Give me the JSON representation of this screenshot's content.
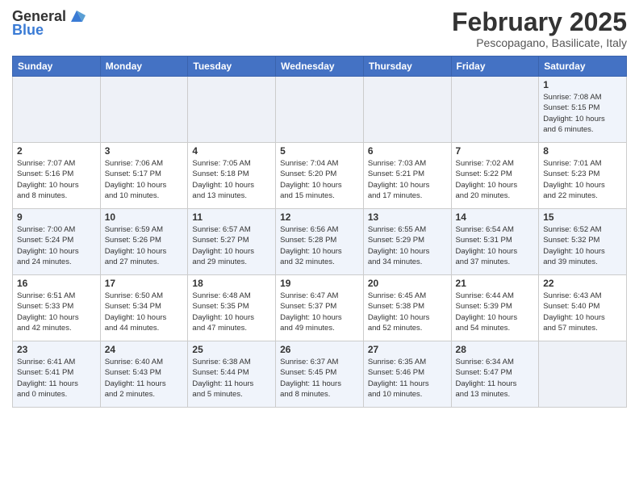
{
  "header": {
    "logo_general": "General",
    "logo_blue": "Blue",
    "month_title": "February 2025",
    "subtitle": "Pescopagano, Basilicate, Italy"
  },
  "weekdays": [
    "Sunday",
    "Monday",
    "Tuesday",
    "Wednesday",
    "Thursday",
    "Friday",
    "Saturday"
  ],
  "weeks": [
    [
      {
        "day": "",
        "info": ""
      },
      {
        "day": "",
        "info": ""
      },
      {
        "day": "",
        "info": ""
      },
      {
        "day": "",
        "info": ""
      },
      {
        "day": "",
        "info": ""
      },
      {
        "day": "",
        "info": ""
      },
      {
        "day": "1",
        "info": "Sunrise: 7:08 AM\nSunset: 5:15 PM\nDaylight: 10 hours\nand 6 minutes."
      }
    ],
    [
      {
        "day": "2",
        "info": "Sunrise: 7:07 AM\nSunset: 5:16 PM\nDaylight: 10 hours\nand 8 minutes."
      },
      {
        "day": "3",
        "info": "Sunrise: 7:06 AM\nSunset: 5:17 PM\nDaylight: 10 hours\nand 10 minutes."
      },
      {
        "day": "4",
        "info": "Sunrise: 7:05 AM\nSunset: 5:18 PM\nDaylight: 10 hours\nand 13 minutes."
      },
      {
        "day": "5",
        "info": "Sunrise: 7:04 AM\nSunset: 5:20 PM\nDaylight: 10 hours\nand 15 minutes."
      },
      {
        "day": "6",
        "info": "Sunrise: 7:03 AM\nSunset: 5:21 PM\nDaylight: 10 hours\nand 17 minutes."
      },
      {
        "day": "7",
        "info": "Sunrise: 7:02 AM\nSunset: 5:22 PM\nDaylight: 10 hours\nand 20 minutes."
      },
      {
        "day": "8",
        "info": "Sunrise: 7:01 AM\nSunset: 5:23 PM\nDaylight: 10 hours\nand 22 minutes."
      }
    ],
    [
      {
        "day": "9",
        "info": "Sunrise: 7:00 AM\nSunset: 5:24 PM\nDaylight: 10 hours\nand 24 minutes."
      },
      {
        "day": "10",
        "info": "Sunrise: 6:59 AM\nSunset: 5:26 PM\nDaylight: 10 hours\nand 27 minutes."
      },
      {
        "day": "11",
        "info": "Sunrise: 6:57 AM\nSunset: 5:27 PM\nDaylight: 10 hours\nand 29 minutes."
      },
      {
        "day": "12",
        "info": "Sunrise: 6:56 AM\nSunset: 5:28 PM\nDaylight: 10 hours\nand 32 minutes."
      },
      {
        "day": "13",
        "info": "Sunrise: 6:55 AM\nSunset: 5:29 PM\nDaylight: 10 hours\nand 34 minutes."
      },
      {
        "day": "14",
        "info": "Sunrise: 6:54 AM\nSunset: 5:31 PM\nDaylight: 10 hours\nand 37 minutes."
      },
      {
        "day": "15",
        "info": "Sunrise: 6:52 AM\nSunset: 5:32 PM\nDaylight: 10 hours\nand 39 minutes."
      }
    ],
    [
      {
        "day": "16",
        "info": "Sunrise: 6:51 AM\nSunset: 5:33 PM\nDaylight: 10 hours\nand 42 minutes."
      },
      {
        "day": "17",
        "info": "Sunrise: 6:50 AM\nSunset: 5:34 PM\nDaylight: 10 hours\nand 44 minutes."
      },
      {
        "day": "18",
        "info": "Sunrise: 6:48 AM\nSunset: 5:35 PM\nDaylight: 10 hours\nand 47 minutes."
      },
      {
        "day": "19",
        "info": "Sunrise: 6:47 AM\nSunset: 5:37 PM\nDaylight: 10 hours\nand 49 minutes."
      },
      {
        "day": "20",
        "info": "Sunrise: 6:45 AM\nSunset: 5:38 PM\nDaylight: 10 hours\nand 52 minutes."
      },
      {
        "day": "21",
        "info": "Sunrise: 6:44 AM\nSunset: 5:39 PM\nDaylight: 10 hours\nand 54 minutes."
      },
      {
        "day": "22",
        "info": "Sunrise: 6:43 AM\nSunset: 5:40 PM\nDaylight: 10 hours\nand 57 minutes."
      }
    ],
    [
      {
        "day": "23",
        "info": "Sunrise: 6:41 AM\nSunset: 5:41 PM\nDaylight: 11 hours\nand 0 minutes."
      },
      {
        "day": "24",
        "info": "Sunrise: 6:40 AM\nSunset: 5:43 PM\nDaylight: 11 hours\nand 2 minutes."
      },
      {
        "day": "25",
        "info": "Sunrise: 6:38 AM\nSunset: 5:44 PM\nDaylight: 11 hours\nand 5 minutes."
      },
      {
        "day": "26",
        "info": "Sunrise: 6:37 AM\nSunset: 5:45 PM\nDaylight: 11 hours\nand 8 minutes."
      },
      {
        "day": "27",
        "info": "Sunrise: 6:35 AM\nSunset: 5:46 PM\nDaylight: 11 hours\nand 10 minutes."
      },
      {
        "day": "28",
        "info": "Sunrise: 6:34 AM\nSunset: 5:47 PM\nDaylight: 11 hours\nand 13 minutes."
      },
      {
        "day": "",
        "info": ""
      }
    ]
  ]
}
